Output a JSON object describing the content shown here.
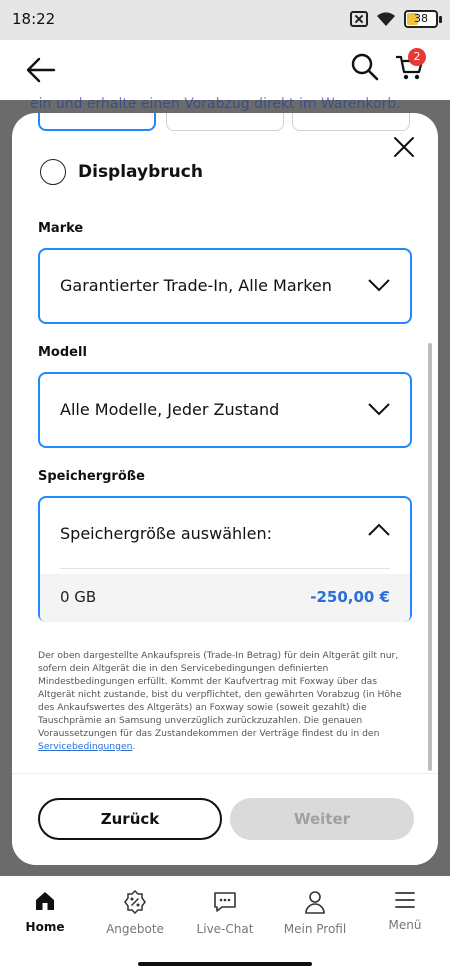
{
  "status_bar": {
    "time": "18:22",
    "battery": "38"
  },
  "header": {
    "cart_count": "2"
  },
  "background_text": "ein und erhalte einen Vorabzug direkt im Warenkorb.",
  "modal": {
    "damage_option": "Displaybruch",
    "brand": {
      "label": "Marke",
      "value": "Garantierter Trade-In, Alle Marken"
    },
    "model": {
      "label": "Modell",
      "value": "Alle Modelle, Jeder Zustand"
    },
    "storage": {
      "label": "Speichergröße",
      "placeholder": "Speichergröße auswählen:",
      "options": [
        {
          "size": "0 GB",
          "price": "-250,00 €"
        }
      ]
    },
    "disclaimer": {
      "text": "Der oben dargestellte Ankaufspreis (Trade-In Betrag) für dein Altgerät gilt nur, sofern dein Altgerät die in den Servicebedingungen definierten Mindestbedingungen erfüllt. Kommt der Kaufvertrag mit Foxway über das Altgerät nicht zustande, bist du verpflichtet, den gewährten Vorabzug (in Höhe des Ankaufswertes des Altgeräts) an Foxway sowie (soweit gezahlt) die Tauschprämie an Samsung unverzüglich zurückzuzahlen. Die genauen Voraussetzungen für das Zustandekommen der Verträge findest du in den ",
      "link": "Servicebedingungen",
      "end": "."
    },
    "back_label": "Zurück",
    "next_label": "Weiter"
  },
  "bottom_nav": [
    {
      "label": "Home"
    },
    {
      "label": "Angebote"
    },
    {
      "label": "Live-Chat"
    },
    {
      "label": "Mein Profil"
    },
    {
      "label": "Menü"
    }
  ],
  "colors": {
    "accent": "#2189ff",
    "price": "#2a6fd6",
    "badge": "#e53935"
  }
}
